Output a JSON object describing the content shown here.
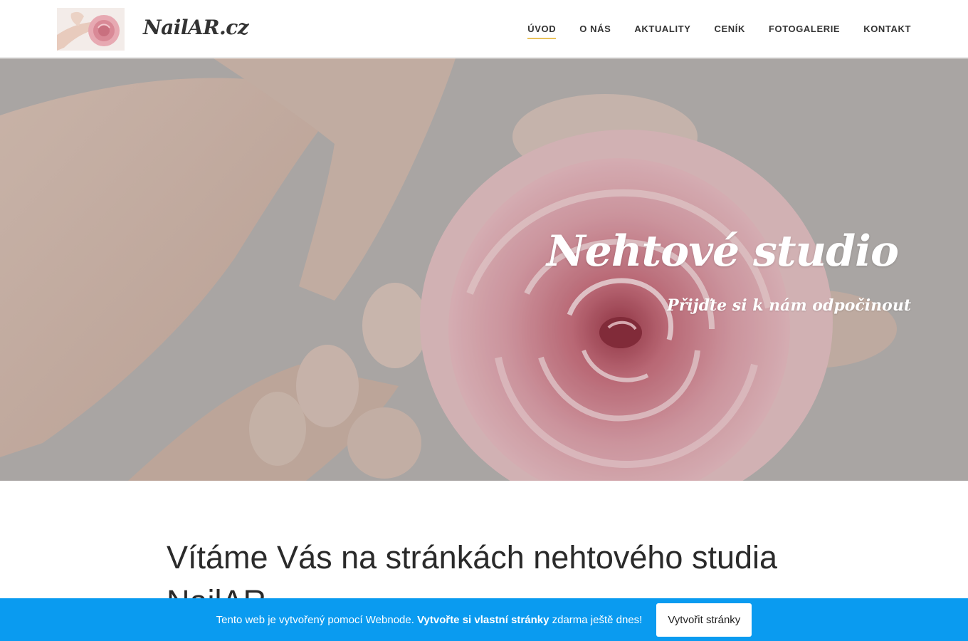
{
  "header": {
    "logo_text": "NailAR.cz",
    "nav": [
      {
        "label": "ÚVOD",
        "active": true
      },
      {
        "label": "O NÁS",
        "active": false
      },
      {
        "label": "AKTUALITY",
        "active": false
      },
      {
        "label": "CENÍK",
        "active": false
      },
      {
        "label": "FOTOGALERIE",
        "active": false
      },
      {
        "label": "KONTAKT",
        "active": false
      }
    ]
  },
  "hero": {
    "title": "Nehtové studio",
    "subtitle": "Přijďte si k nám odpočinout"
  },
  "main": {
    "heading": "Vítáme Vás na stránkách nehtového studia NailAR"
  },
  "promo": {
    "text_before": "Tento web je vytvořený pomocí Webnode. ",
    "text_bold": "Vytvořte si vlastní stránky",
    "text_after": " zdarma ještě dnes!",
    "button_label": "Vytvořit stránky"
  },
  "colors": {
    "accent_underline": "#e9c25a",
    "promo_bar": "#0a9bf0"
  }
}
